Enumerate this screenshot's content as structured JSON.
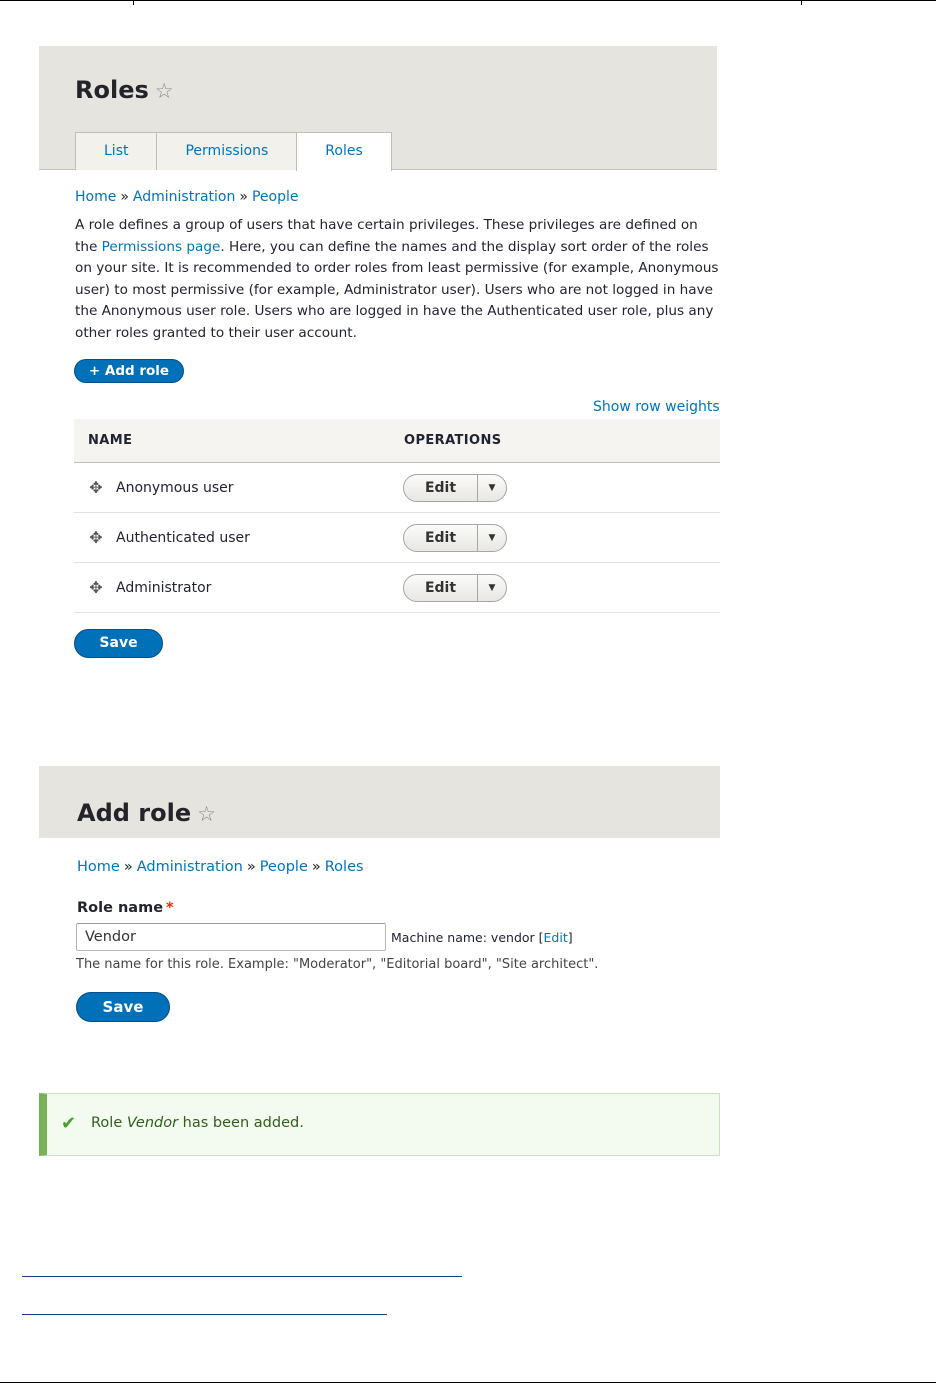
{
  "roles_page": {
    "title": "Roles",
    "star_icon": "☆",
    "tabs": [
      {
        "label": "List"
      },
      {
        "label": "Permissions"
      },
      {
        "label": "Roles",
        "active": true
      }
    ],
    "breadcrumb": [
      {
        "label": "Home"
      },
      {
        "label": "Administration"
      },
      {
        "label": "People"
      }
    ],
    "breadcrumb_separator": "»",
    "intro": {
      "part1": "A role defines a group of users that have certain privileges. These privileges are defined on the ",
      "link": "Permissions page",
      "part2": ". Here, you can define the names and the display sort order of the roles on your site. It is recommended to order roles from least permissive (for example, Anonymous user) to most permissive (for example, Administrator user). Users who are not logged in have the Anonymous user role. Users who are logged in have the Authenticated user role, plus any other roles granted to their user account."
    },
    "add_role_button": "+ Add role",
    "show_row_weights": "Show row weights",
    "table": {
      "headers": {
        "name": "NAME",
        "operations": "OPERATIONS"
      },
      "rows": [
        {
          "name": "Anonymous user",
          "edit": "Edit"
        },
        {
          "name": "Authenticated user",
          "edit": "Edit"
        },
        {
          "name": "Administrator",
          "edit": "Edit"
        }
      ]
    },
    "save_button": "Save"
  },
  "add_role_page": {
    "title": "Add role",
    "star_icon": "☆",
    "breadcrumb": [
      {
        "label": "Home"
      },
      {
        "label": "Administration"
      },
      {
        "label": "People"
      },
      {
        "label": "Roles"
      }
    ],
    "role_name_label": "Role name",
    "required_marker": "*",
    "role_name_value": "Vendor",
    "machine_name_prefix": "Machine name: vendor ",
    "machine_name_edit": "Edit",
    "description": "The name for this role. Example: \"Moderator\", \"Editorial board\", \"Site architect\".",
    "save_button": "Save"
  },
  "status_message": {
    "prefix": "Role ",
    "role": "Vendor",
    "suffix": " has been added.",
    "icon": "check-icon",
    "accent_color": "#77b259"
  },
  "colors": {
    "link": "#0074bd",
    "primary_button": "#0071b8",
    "header_bg": "#e6e4df"
  }
}
